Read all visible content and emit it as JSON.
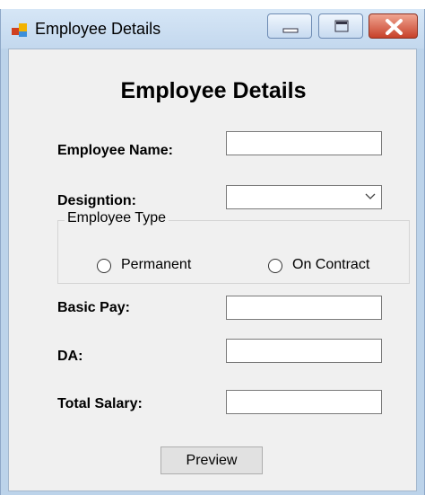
{
  "window": {
    "title": "Employee Details"
  },
  "form": {
    "heading": "Employee Details",
    "employee_name_label": "Employee Name:",
    "designation_label": "Designtion:",
    "designation_value": "",
    "employee_type_group": "Employee Type",
    "radio_permanent": "Permanent",
    "radio_contract": "On Contract",
    "basic_pay_label": "Basic Pay:",
    "da_label": "DA:",
    "total_salary_label": "Total Salary:",
    "preview_button": "Preview"
  },
  "icons": {
    "app": "app-icon",
    "minimize": "minimize-icon",
    "maximize": "maximize-icon",
    "close": "close-icon",
    "dropdown": "chevron-down-icon"
  },
  "colors": {
    "title_bar": "#c3d8ee",
    "client_bg": "#f0f0f0",
    "close_button": "#c7412a"
  }
}
